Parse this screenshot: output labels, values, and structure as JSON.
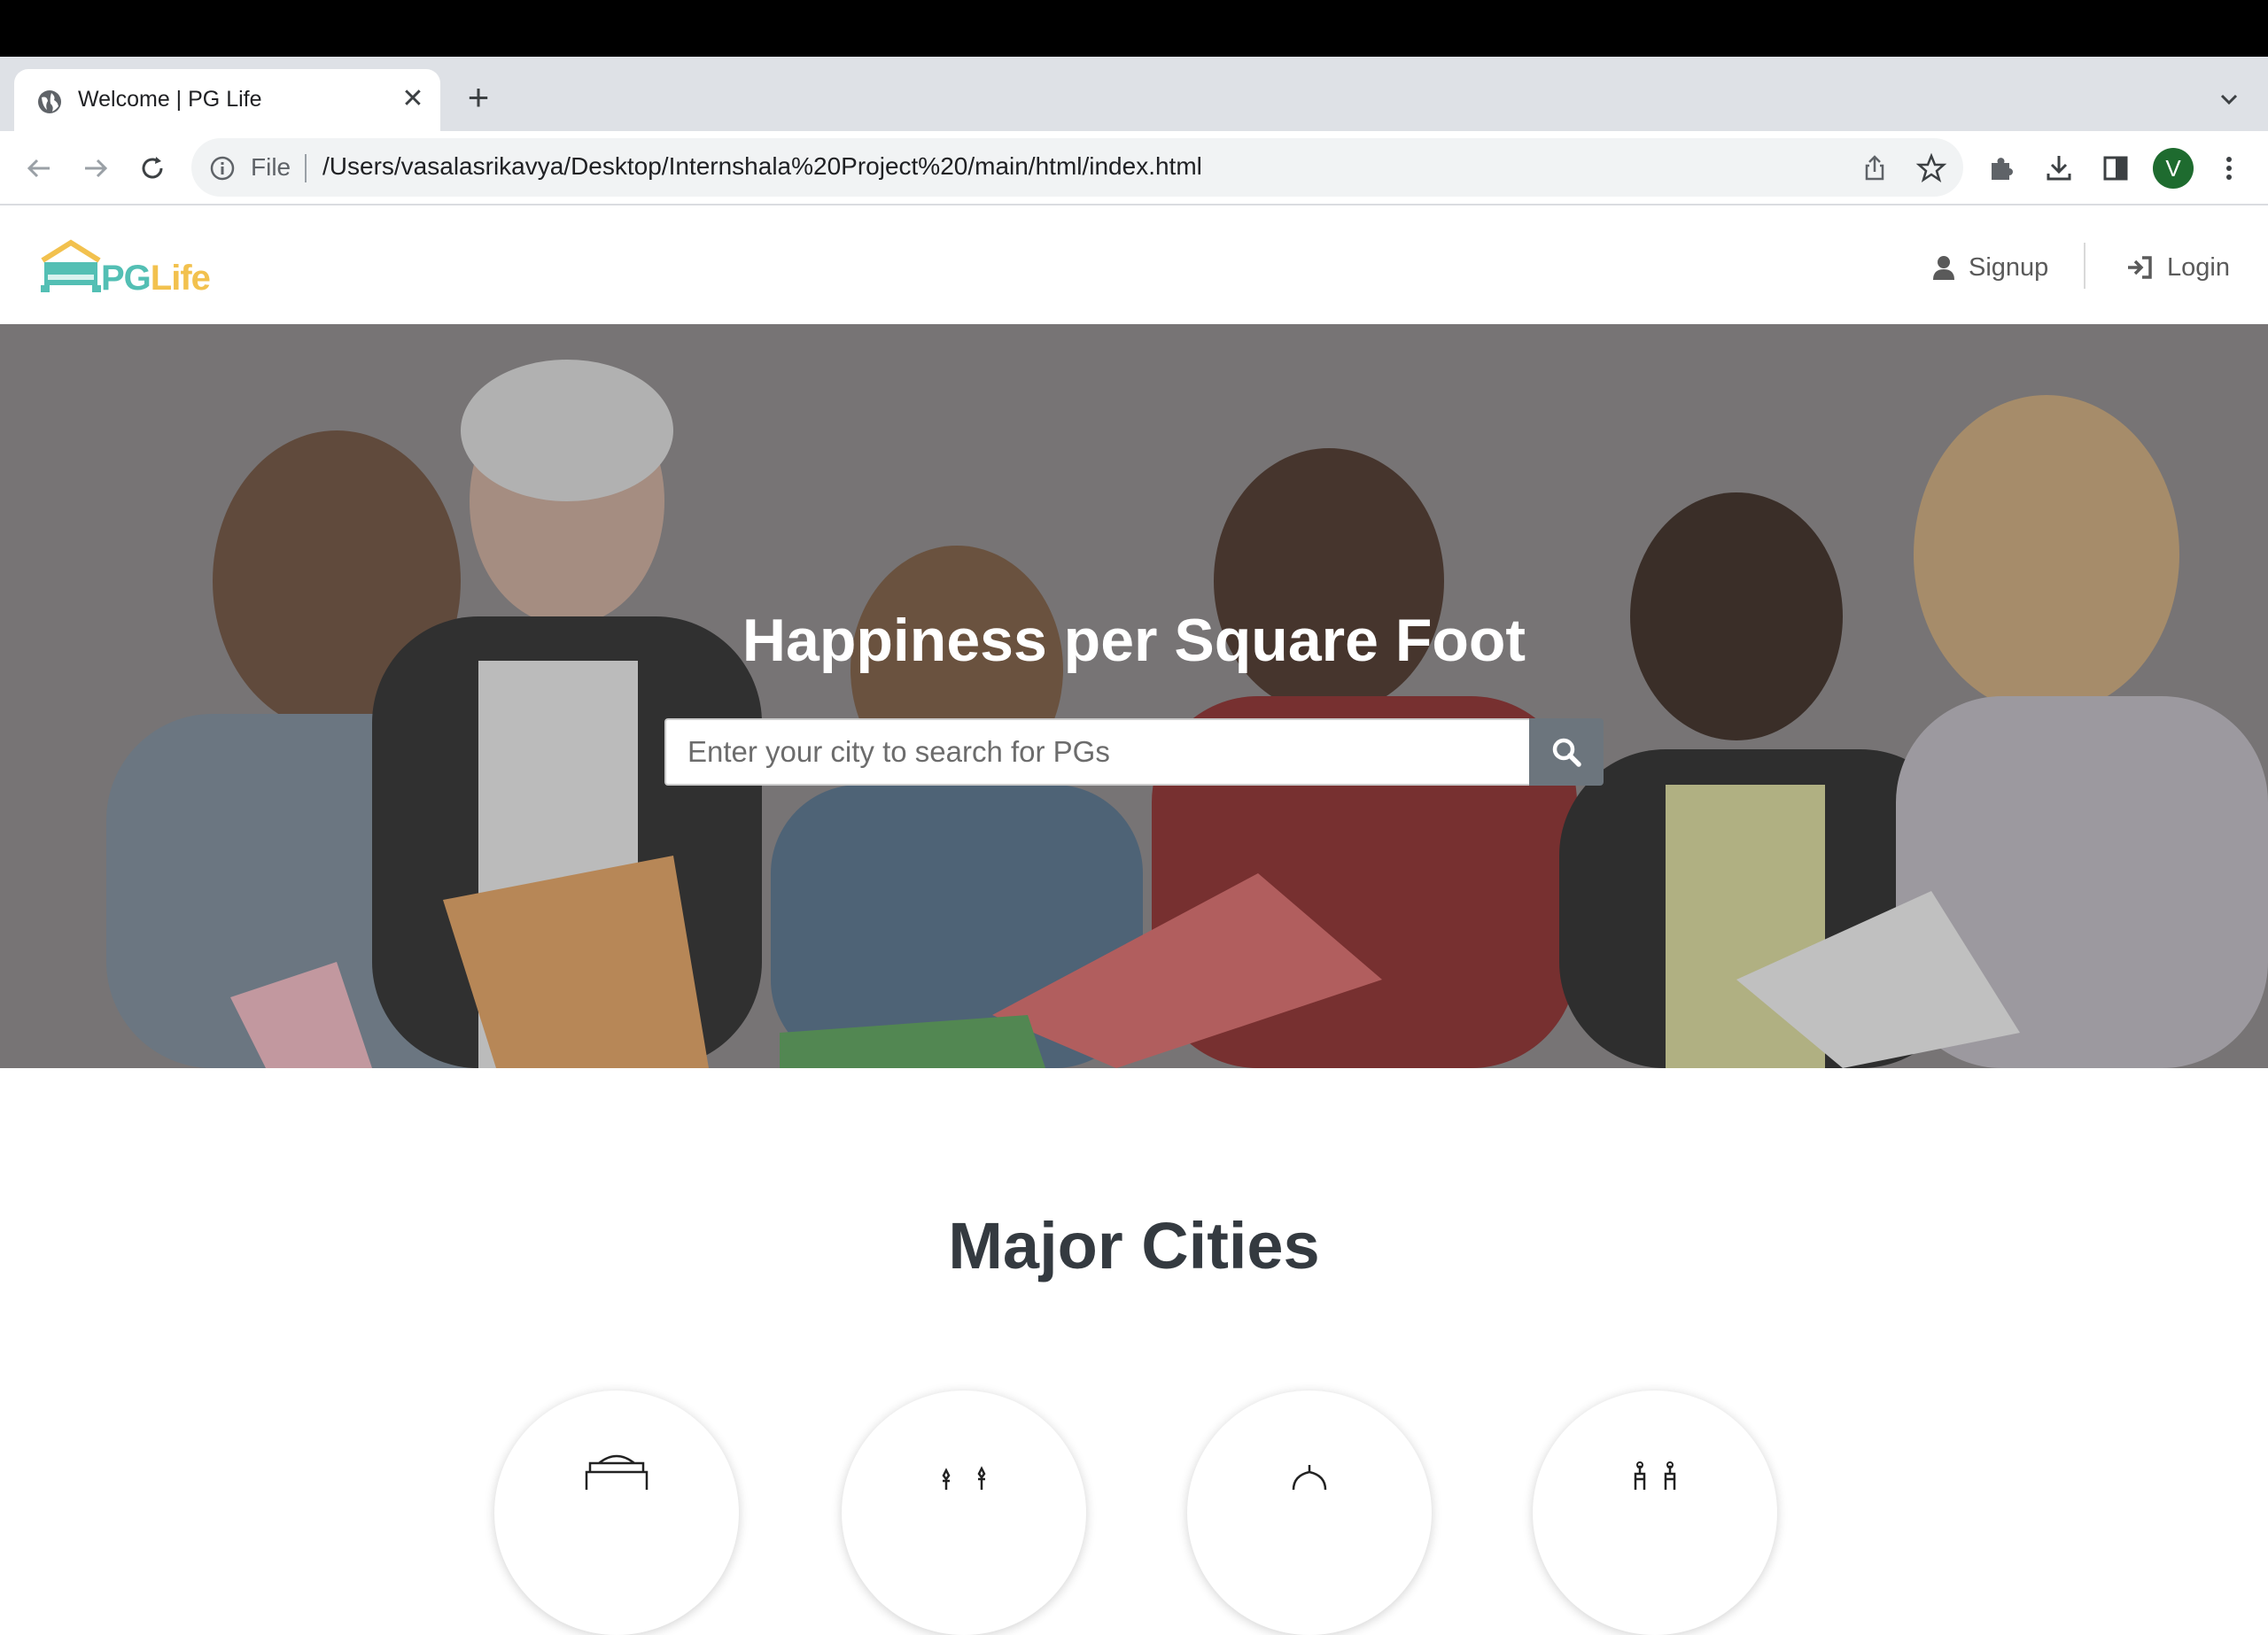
{
  "browser": {
    "tab_title": "Welcome | PG Life",
    "tab_close": "✕",
    "new_tab": "+",
    "url_scheme": "File",
    "url": "/Users/vasalasrikavya/Desktop/Internshala%20Project%20/main/html/index.html",
    "profile_initial": "V"
  },
  "header": {
    "logo_pg": "PG",
    "logo_life": "Life",
    "signup_label": "Signup",
    "login_label": "Login"
  },
  "hero": {
    "title": "Happiness per Square Foot",
    "search_placeholder": "Enter your city to search for PGs"
  },
  "cities": {
    "title": "Major Cities",
    "cards": [
      {
        "icon": "delhi-monument-icon"
      },
      {
        "icon": "mumbai-monument-icon"
      },
      {
        "icon": "bengaluru-monument-icon"
      },
      {
        "icon": "hyderabad-monument-icon"
      }
    ]
  },
  "colors": {
    "logo_teal": "#53bfb4",
    "logo_yellow": "#f2c14e",
    "search_button": "#6c757d",
    "profile_avatar": "#1e6b2f"
  }
}
